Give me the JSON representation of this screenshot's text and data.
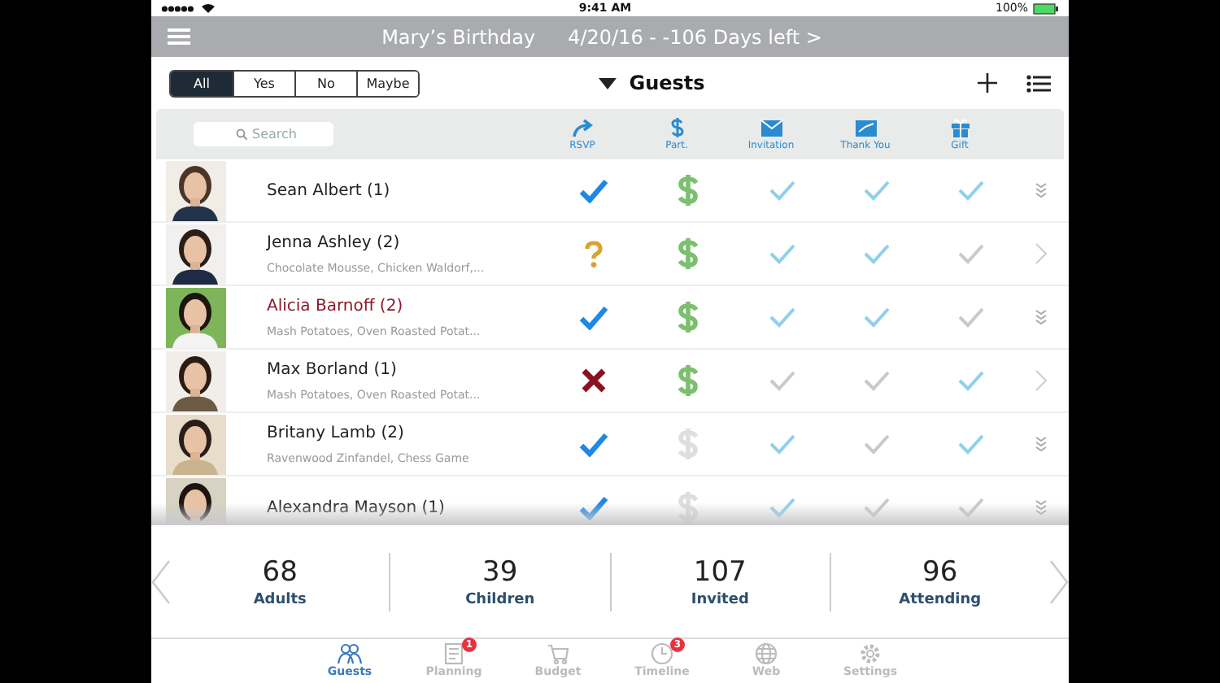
{
  "status_bar": {
    "time": "9:41 AM",
    "battery": "100%"
  },
  "header": {
    "title": "Mary’s Birthday",
    "date": "4/20/16 - -106 Days left >"
  },
  "filters": [
    {
      "label": "All",
      "selected": true
    },
    {
      "label": "Yes",
      "selected": false
    },
    {
      "label": "No",
      "selected": false
    },
    {
      "label": "Maybe",
      "selected": false
    }
  ],
  "section_title": "Guests",
  "search": {
    "placeholder": "Search"
  },
  "columns": [
    {
      "label": "RSVP",
      "kind": "rsvp"
    },
    {
      "label": "Part.",
      "kind": "paid"
    },
    {
      "label": "Invitation",
      "kind": "invitation"
    },
    {
      "label": "Thank You",
      "kind": "thankyou"
    },
    {
      "label": "Gift",
      "kind": "gift"
    }
  ],
  "guests": [
    {
      "name": "Sean Albert (1)",
      "highlighted": false,
      "rsvp": {
        "kind": "yes"
      },
      "paid": true,
      "invitation": true,
      "thank_you": true,
      "gift": true,
      "expandable": true
    },
    {
      "name": "Jenna Ashley  (2)",
      "note": "Chocolate Mousse, Chicken Waldorf,...",
      "highlighted": false,
      "rsvp": {
        "kind": "maybe"
      },
      "paid": true,
      "invitation": true,
      "thank_you": true,
      "gift": false,
      "expandable": false
    },
    {
      "name": "Alicia Barnoff (2)",
      "note": "Mash Potatoes, Oven Roasted Potat...",
      "highlighted": true,
      "rsvp": {
        "kind": "yes"
      },
      "paid": true,
      "invitation": true,
      "thank_you": true,
      "gift": false,
      "expandable": true
    },
    {
      "name": "Max Borland (1)",
      "note": "Mash Potatoes, Oven Roasted Potat...",
      "highlighted": false,
      "rsvp": {
        "kind": "no"
      },
      "paid": true,
      "invitation": false,
      "thank_you": false,
      "gift": true,
      "expandable": false
    },
    {
      "name": "Britany Lamb (2)",
      "note": "Ravenwood Zinfandel, Chess Game",
      "highlighted": false,
      "rsvp": {
        "kind": "yes"
      },
      "paid": false,
      "invitation": true,
      "thank_you": false,
      "gift": true,
      "expandable": true
    },
    {
      "name": "Alexandra Mayson (1)",
      "highlighted": false,
      "rsvp": {
        "kind": "yes"
      },
      "paid": false,
      "invitation": true,
      "thank_you": false,
      "gift": false,
      "expandable": true
    }
  ],
  "stats": [
    {
      "value": "68",
      "label": "Adults"
    },
    {
      "value": "39",
      "label": "Children"
    },
    {
      "value": "107",
      "label": "Invited"
    },
    {
      "value": "96",
      "label": "Attending"
    }
  ],
  "tabs": [
    {
      "label": "Guests",
      "kind": "people",
      "selected": true
    },
    {
      "label": "Planning",
      "kind": "list",
      "selected": false,
      "badge": "1"
    },
    {
      "label": "Budget",
      "kind": "cart",
      "selected": false
    },
    {
      "label": "Timeline",
      "kind": "clock",
      "selected": false,
      "badge": "3"
    },
    {
      "label": "Web",
      "kind": "globe",
      "selected": false
    },
    {
      "label": "Settings",
      "kind": "gear",
      "selected": false
    }
  ]
}
